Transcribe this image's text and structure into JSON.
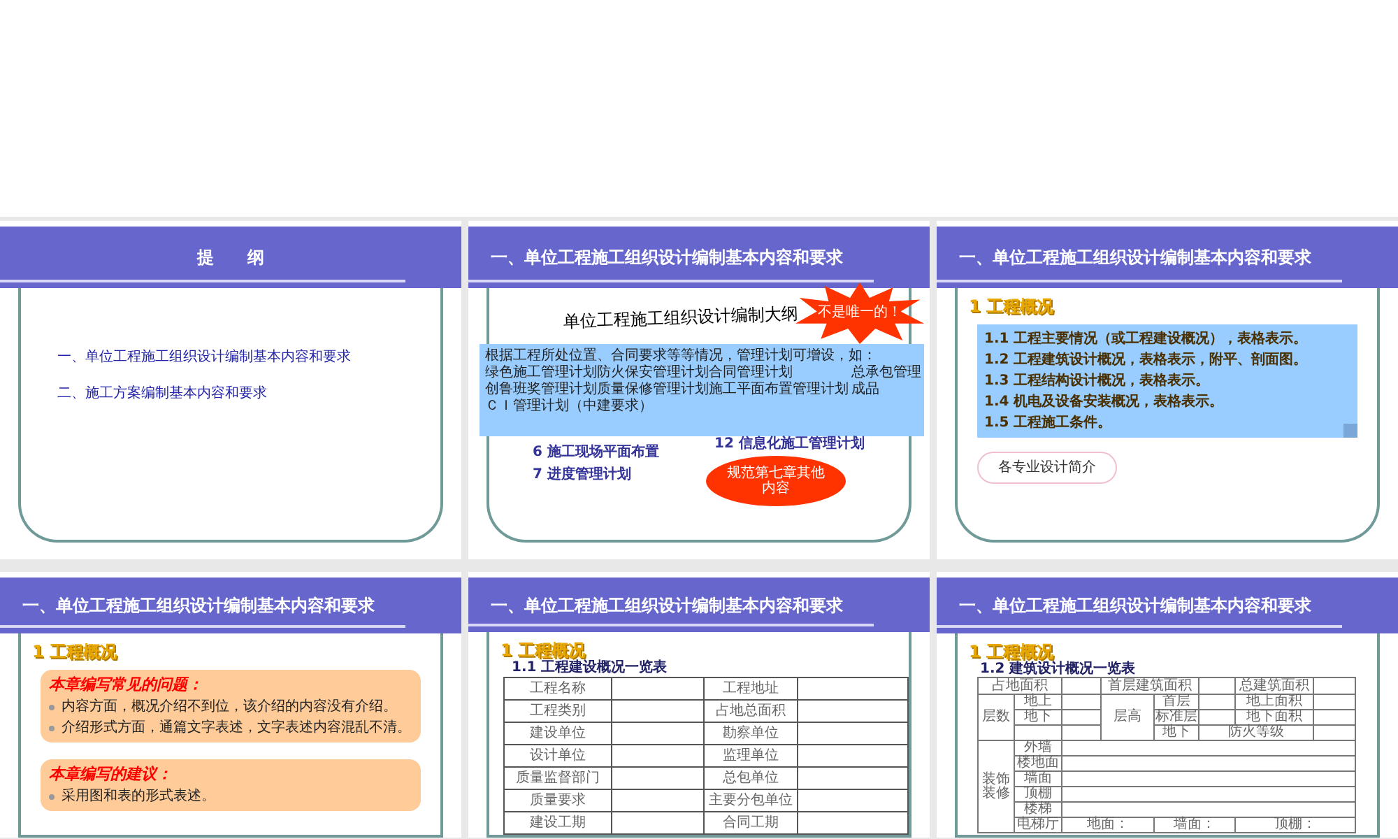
{
  "slides": [
    {
      "kind": "outline",
      "title": "提　　纲",
      "items": [
        "一、单位工程施工组织设计编制基本内容和要求",
        "二、施工方案编制基本内容和要求"
      ]
    },
    {
      "kind": "plan",
      "title": "一、单位工程施工组织设计编制基本内容和要求",
      "heading": "单位工程施工组织设计编制大纲",
      "burst": "不是唯一的！",
      "note_intro": "根据工程所处位置、合同要求等等情况，管理计划可增设，如：",
      "note_items": [
        "绿色施工管理计划",
        "防火保安管理计划",
        "合同管理计划",
        "总承包管理",
        "创鲁班奖管理计划",
        "质量保修管理计划",
        "施工平面布置管理计划",
        "成品"
      ],
      "note_footer": "ＣＩ管理计划（中建要求）",
      "left_items": [
        "6  施工现场平面布置",
        "7  进度管理计划"
      ],
      "right_item": "12  信息化施工管理计划",
      "bubble": "规范第七章其他内容"
    },
    {
      "kind": "overview",
      "title": "一、单位工程施工组织设计编制基本内容和要求",
      "section": "1  工程概况",
      "lines": [
        "1.1 工程主要情况（或工程建设概况），表格表示。",
        "1.2 工程建筑设计概况，表格表示，附平、剖面图。",
        "1.3 工程结构设计概况，表格表示。",
        "1.4 机电及设备安装概况，表格表示。",
        "1.5 工程施工条件。"
      ],
      "cloud": "各专业设计简介"
    },
    {
      "kind": "advice",
      "title": "一、单位工程施工组织设计编制基本内容和要求",
      "section": "1  工程概况",
      "boxes": [
        {
          "heading": "本章编写常见的问题：",
          "bullets": [
            "内容方面，概况介绍不到位，该介绍的内容没有介绍。",
            "介绍形式方面，通篇文字表述，文字表述内容混乱不清。"
          ]
        },
        {
          "heading": "本章编写的建议：",
          "bullets": [
            "采用图和表的形式表述。"
          ]
        }
      ]
    },
    {
      "kind": "table",
      "title": "一、单位工程施工组织设计编制基本内容和要求",
      "section": "1  工程概况",
      "subtitle": "1.1  工程建设概况一览表",
      "rows": [
        [
          "工程名称",
          "工程地址"
        ],
        [
          "工程类别",
          "占地总面积"
        ],
        [
          "建设单位",
          "勘察单位"
        ],
        [
          "设计单位",
          "监理单位"
        ],
        [
          "质量监督部门",
          "总包单位"
        ],
        [
          "质量要求",
          "主要分包单位"
        ],
        [
          "建设工期",
          "合同工期"
        ]
      ]
    },
    {
      "kind": "design_table",
      "title": "一、单位工程施工组织设计编制基本内容和要求",
      "section": "1  工程概况",
      "subtitle": "1.2  建筑设计概况一览表",
      "table": {
        "site_area": "占地面积",
        "first_floor_area": "首层建筑面积",
        "total_area": "总建筑面积",
        "floors": "层数",
        "above": "地上",
        "below": "地下",
        "floor_height": "层高",
        "first": "首层",
        "standard": "标准层",
        "basement": "地下",
        "above_area": "地上面积",
        "below_area": "地下面积",
        "fire_rating": "防火等级",
        "decoration": "装饰装修",
        "decoration_items": [
          "外墙",
          "楼地面",
          "墙面",
          "顶棚",
          "楼梯"
        ],
        "lobby": "电梯厅",
        "lobby_cells": [
          "地面：",
          "墙面：",
          "顶棚："
        ]
      }
    }
  ]
}
